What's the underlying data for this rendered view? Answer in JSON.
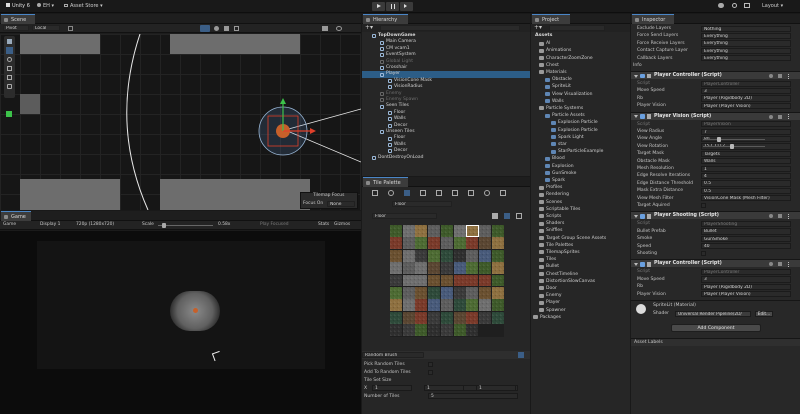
{
  "toolbar": {
    "account_label": "Unity 6",
    "user_label": "EH",
    "asset_store_label": "Asset Store",
    "play_icon": "play-icon",
    "pause_icon": "pause-icon",
    "step_icon": "step-icon",
    "layout_label": "Layout"
  },
  "scene": {
    "tab_label": "Scene",
    "pivot_label": "Pivot",
    "local_label": "Local",
    "tilemap_focus_title": "Tilemap Focus",
    "focus_on_label": "Focus On",
    "focus_on_value": "None"
  },
  "game": {
    "tab_label": "Game",
    "display_label": "Game",
    "display_value": "Display 1",
    "resolution_value": "720p (1280x720)",
    "scale_label": "Scale",
    "scale_value": "0.58x",
    "play_focused_label": "Play Focused",
    "stats_label": "Stats",
    "gizmos_label": "Gizmos"
  },
  "hierarchy": {
    "tab_label": "Hierarchy",
    "search_placeholder": "All",
    "items": [
      {
        "label": "TopDownGame",
        "indent": 0,
        "bold": true
      },
      {
        "label": "Main Camera",
        "indent": 1
      },
      {
        "label": "CM vcam1",
        "indent": 1
      },
      {
        "label": "EventSystem",
        "indent": 1
      },
      {
        "label": "Global Light",
        "indent": 1,
        "dim": true
      },
      {
        "label": "Crosshair",
        "indent": 1
      },
      {
        "label": "Player",
        "indent": 1,
        "selected": true
      },
      {
        "label": "VisionCone Mask",
        "indent": 2
      },
      {
        "label": "VisionRadius",
        "indent": 2
      },
      {
        "label": "Enemy",
        "indent": 1,
        "dim": true
      },
      {
        "label": "Enemy Spawn",
        "indent": 1,
        "dim": true
      },
      {
        "label": "Seen Tiles",
        "indent": 1
      },
      {
        "label": "Floor",
        "indent": 2
      },
      {
        "label": "Walls",
        "indent": 2
      },
      {
        "label": "Decor",
        "indent": 2
      },
      {
        "label": "Unseen Tiles",
        "indent": 1
      },
      {
        "label": "Floor",
        "indent": 2
      },
      {
        "label": "Walls",
        "indent": 2
      },
      {
        "label": "Decor",
        "indent": 2
      },
      {
        "label": "DontDestroyOnLoad",
        "indent": 0
      }
    ]
  },
  "palette": {
    "tab_label": "Tile Palette",
    "active_palette": "Floor",
    "palette_name": "Floor",
    "brush_label": "Random Brush",
    "rows": [
      {
        "label": "Pick Random Tiles",
        "value": ""
      },
      {
        "label": "Add To Random Tiles",
        "value": ""
      },
      {
        "label": "Tile Set Size",
        "value": ""
      },
      {
        "label": "X",
        "value": "1"
      },
      {
        "label": "Number of Tiles",
        "value": "5"
      }
    ],
    "tileset_size": {
      "x": "1",
      "y": "1",
      "z": "1"
    }
  },
  "project": {
    "tab_label": "Project",
    "root": "Assets",
    "items": [
      {
        "label": "AI",
        "indent": 1
      },
      {
        "label": "Animations",
        "indent": 1
      },
      {
        "label": "CharacterZoomZone",
        "indent": 1
      },
      {
        "label": "Chest",
        "indent": 1
      },
      {
        "label": "Materials",
        "indent": 1,
        "open": true
      },
      {
        "label": "Obstacle",
        "indent": 2
      },
      {
        "label": "SpriteLit",
        "indent": 2
      },
      {
        "label": "View Visualization",
        "indent": 2
      },
      {
        "label": "Walls",
        "indent": 2
      },
      {
        "label": "Particle Systems",
        "indent": 1,
        "open": true
      },
      {
        "label": "Particle Assets",
        "indent": 2
      },
      {
        "label": "Explosion Particle",
        "indent": 3
      },
      {
        "label": "Explosion Particle",
        "indent": 3
      },
      {
        "label": "Spark Light",
        "indent": 3
      },
      {
        "label": "star",
        "indent": 3
      },
      {
        "label": "StarParticleExample",
        "indent": 3
      },
      {
        "label": "Blood",
        "indent": 2
      },
      {
        "label": "Explosion",
        "indent": 2
      },
      {
        "label": "GunSmoke",
        "indent": 2
      },
      {
        "label": "Spark",
        "indent": 2
      },
      {
        "label": "Profiles",
        "indent": 1
      },
      {
        "label": "Rendering",
        "indent": 1
      },
      {
        "label": "Scenes",
        "indent": 1
      },
      {
        "label": "Scriptable Tiles",
        "indent": 1
      },
      {
        "label": "Scripts",
        "indent": 1
      },
      {
        "label": "Shaders",
        "indent": 1
      },
      {
        "label": "Sniffles",
        "indent": 1
      },
      {
        "label": "Target Group Scene Assets",
        "indent": 1
      },
      {
        "label": "Tile Palettes",
        "indent": 1
      },
      {
        "label": "TilemapSprites",
        "indent": 1
      },
      {
        "label": "Tiles",
        "indent": 1
      },
      {
        "label": "Bullet",
        "indent": 1
      },
      {
        "label": "ChestTimeline",
        "indent": 1
      },
      {
        "label": "DistortionSlowCanvas",
        "indent": 1
      },
      {
        "label": "Door",
        "indent": 1
      },
      {
        "label": "Enemy",
        "indent": 1
      },
      {
        "label": "Player",
        "indent": 1
      },
      {
        "label": "Spawner",
        "indent": 1
      },
      {
        "label": "Packages",
        "indent": 0
      }
    ]
  },
  "inspector": {
    "tab_label": "Inspector",
    "top_rows": [
      {
        "label": "Exclude Layers",
        "value": "Nothing"
      },
      {
        "label": "Force Send Layers",
        "value": "Everything"
      },
      {
        "label": "Force Receive Layers",
        "value": "Everything"
      },
      {
        "label": "Contact Capture Layer",
        "value": "Everything"
      },
      {
        "label": "Callback Layers",
        "value": "Everything"
      }
    ],
    "info_label": "Info",
    "player_controller": {
      "title": "Player Controller (Script)",
      "rows": [
        {
          "label": "Script",
          "value": "PlayerController",
          "dim": true
        },
        {
          "label": "Move Speed",
          "value": "3"
        },
        {
          "label": "Rb",
          "value": "Player (Rigidbody 2D)"
        },
        {
          "label": "Player Vision",
          "value": "Player (Player Vision)"
        }
      ]
    },
    "player_vision": {
      "title": "Player Vision (Script)",
      "rows": [
        {
          "label": "Script",
          "value": "PlayerVision",
          "dim": true
        },
        {
          "label": "View Radius",
          "value": "7"
        },
        {
          "label": "View Angle",
          "value": "80"
        },
        {
          "label": "View Rotation",
          "value": "157.7112"
        },
        {
          "label": "Target Mask",
          "value": "Targets"
        },
        {
          "label": "Obstacle Mask",
          "value": "Walls"
        },
        {
          "label": "Mesh Resolution",
          "value": "1"
        },
        {
          "label": "Edge Resolve Iterations",
          "value": "4"
        },
        {
          "label": "Edge Distance Threshold",
          "value": "0.5"
        },
        {
          "label": "Mask Extra Distance",
          "value": "0.5"
        },
        {
          "label": "View Mesh Filter",
          "value": "VisionCone Mask (Mesh Filter)"
        },
        {
          "label": "Target Aquired",
          "value": ""
        }
      ],
      "view_angle_fraction": 0.22,
      "view_rotation_fraction": 0.44
    },
    "player_shooting": {
      "title": "Player Shooting (Script)",
      "rows": [
        {
          "label": "Script",
          "value": "PlayerShooting",
          "dim": true
        },
        {
          "label": "Bullet Prefab",
          "value": "Bullet"
        },
        {
          "label": "Smoke",
          "value": "GunSmoke"
        },
        {
          "label": "Speed",
          "value": "40"
        },
        {
          "label": "Shooting",
          "value": ""
        }
      ]
    },
    "player_controller_2": {
      "title": "Player Controller (Script)",
      "rows": [
        {
          "label": "Script",
          "value": "PlayerController",
          "dim": true
        },
        {
          "label": "Move Speed",
          "value": "3"
        },
        {
          "label": "Rb",
          "value": "Player (Rigidbody 2D)"
        },
        {
          "label": "Player Vision",
          "value": "Player (Player Vision)"
        }
      ]
    },
    "material": {
      "name": "SpriteLit (Material)",
      "shader_label": "Shader",
      "shader_value": "Universal Render Pipeline/2D/",
      "edit_label": "Edit..."
    },
    "add_component_label": "Add Component",
    "asset_labels": "Asset Labels"
  },
  "colors": {
    "accent": "#4a86c7",
    "selected_row": "#2c5d87",
    "component_check": "#6aa0e0",
    "gizmo_red": "#e0402a",
    "gizmo_green": "#3cc24a"
  }
}
